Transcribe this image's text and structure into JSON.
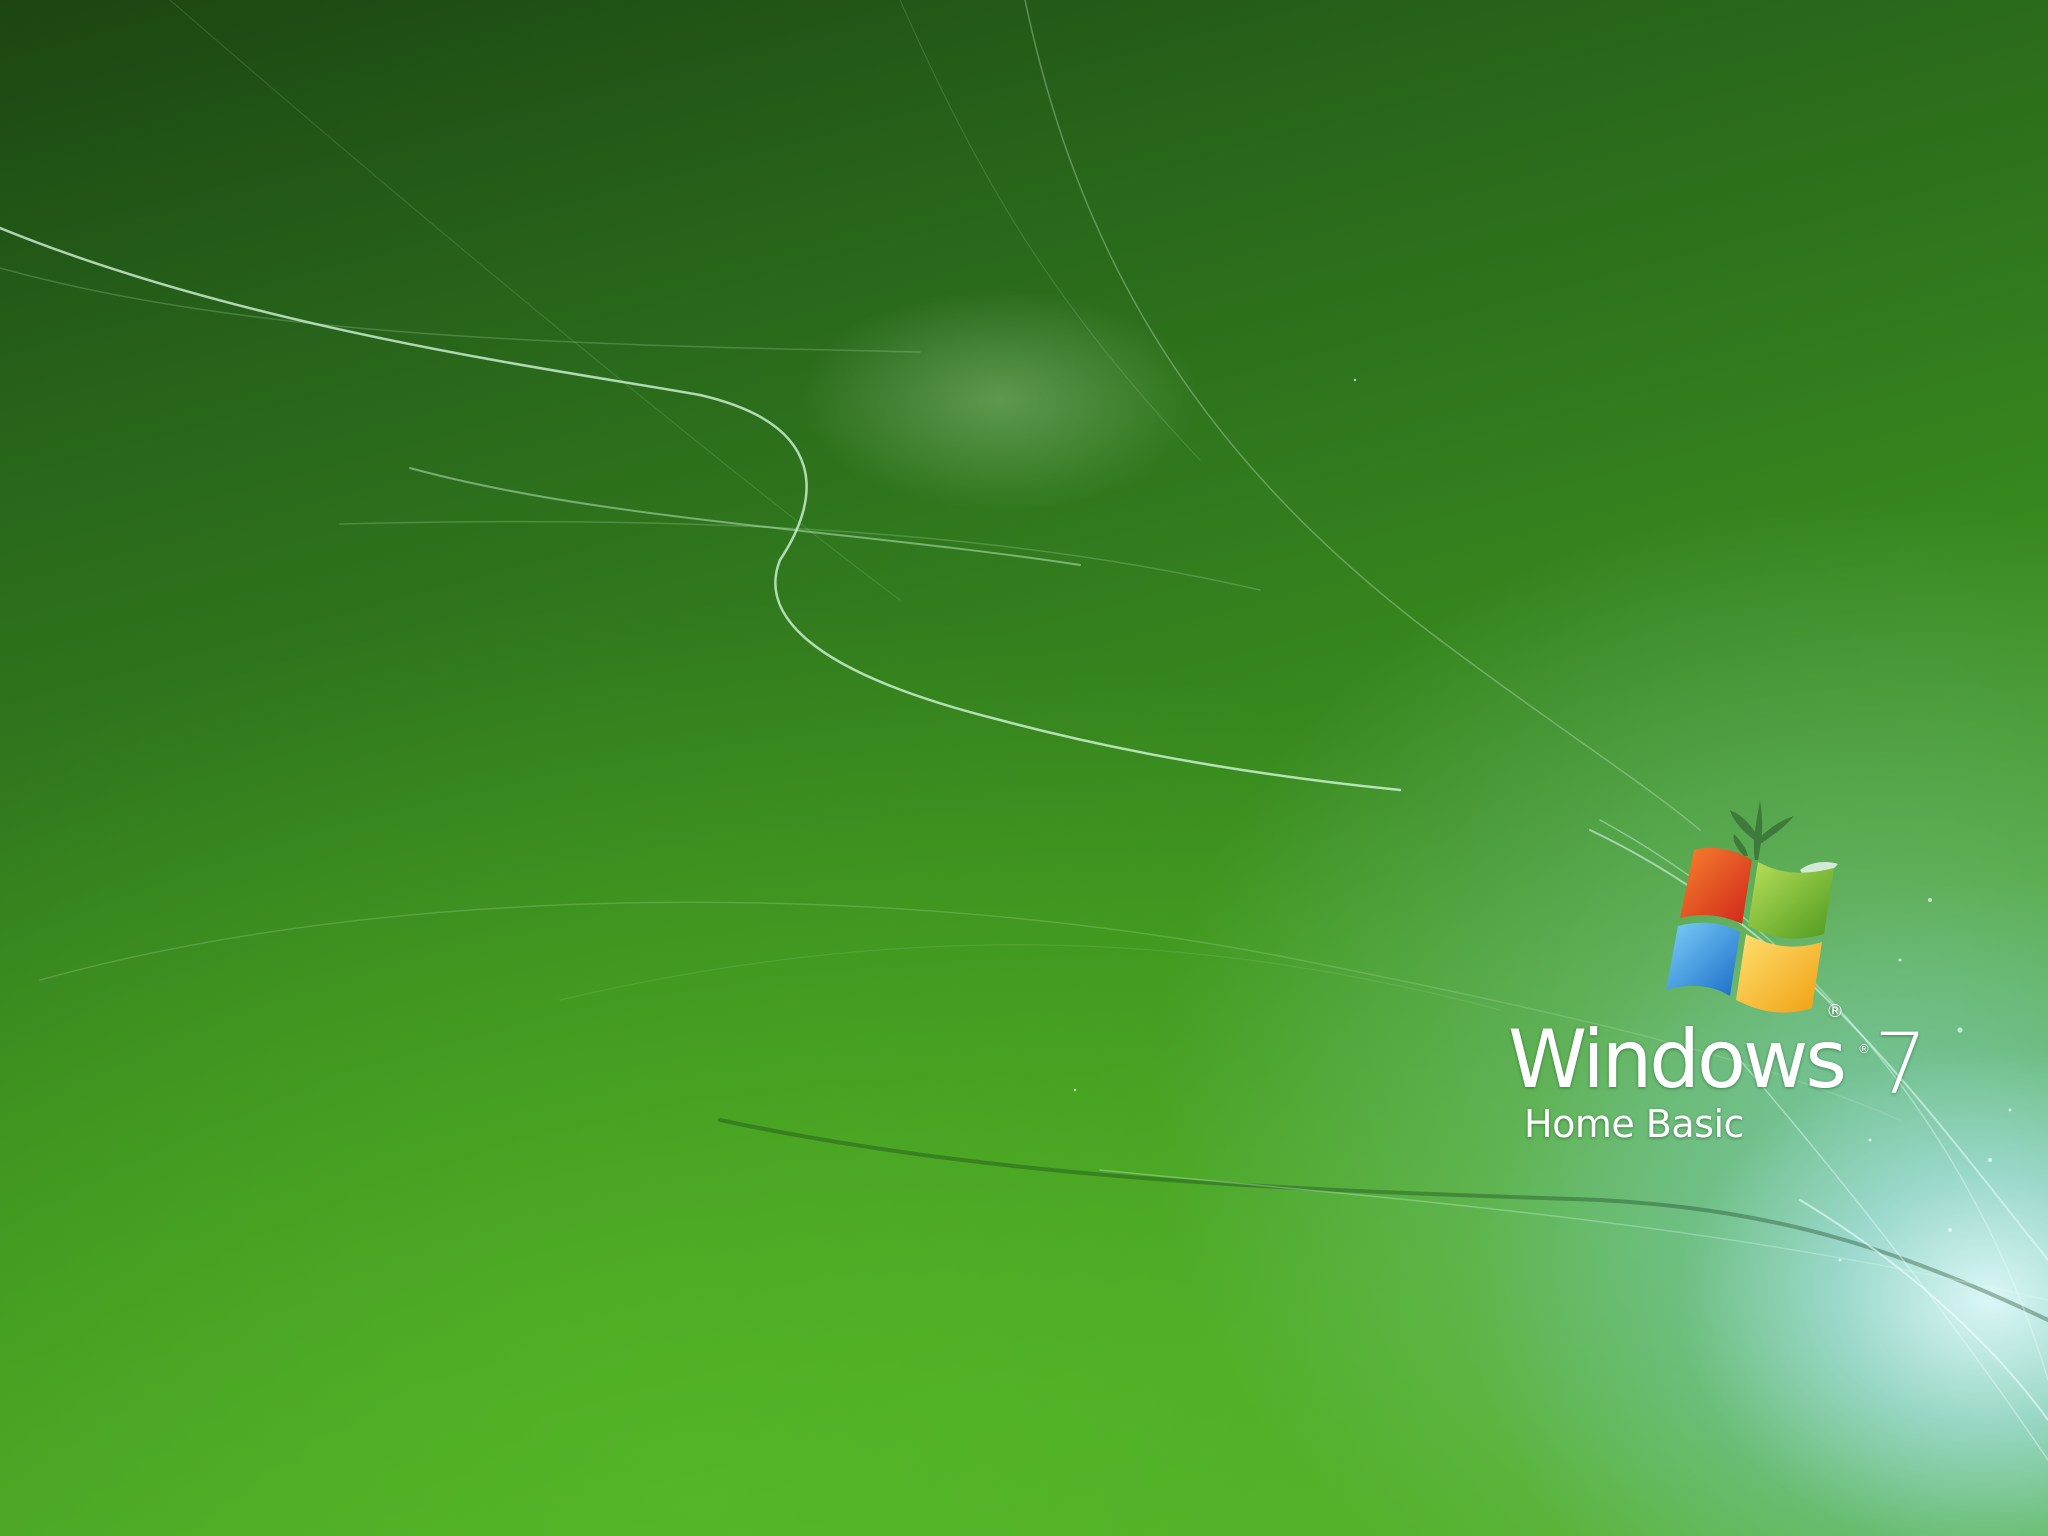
{
  "wallpaper": {
    "colors": {
      "base_dark": "#1c4512",
      "base_mid": "#337d1e",
      "base_light": "#55b12e",
      "glow": "#e1faff"
    }
  },
  "branding": {
    "product_name": "Windows",
    "registered_mark": "®",
    "version": "7",
    "edition": "Home Basic",
    "logo_icon": "windows-flag-icon",
    "logo_colors": {
      "red": "#e8401c",
      "green": "#7cc42c",
      "blue": "#1e88e0",
      "yellow": "#f7b718"
    }
  }
}
